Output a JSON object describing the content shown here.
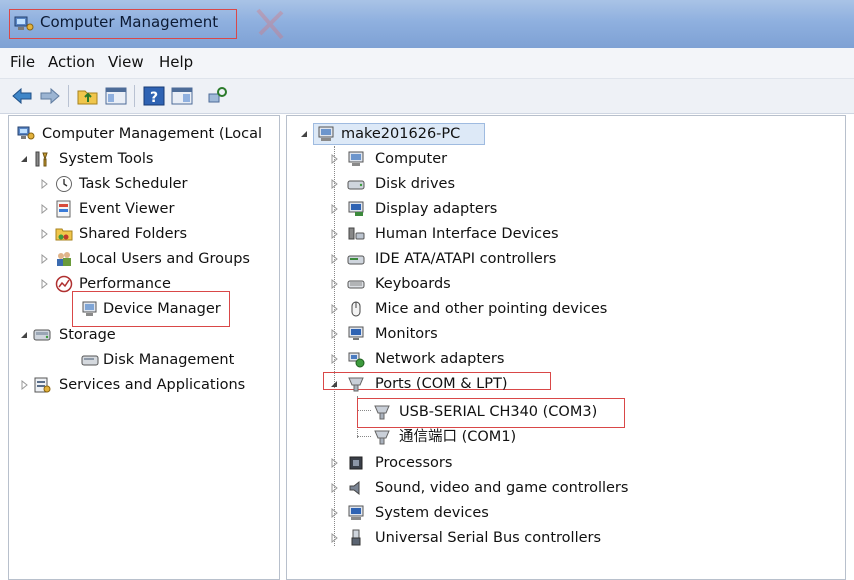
{
  "window": {
    "title": "Computer Management"
  },
  "menu": {
    "items": [
      "File",
      "Action",
      "View",
      "Help"
    ]
  },
  "toolbar": {
    "buttons": [
      "back-icon",
      "forward-icon",
      "up-folder-icon",
      "show-hide-tree-icon",
      "help-icon",
      "properties-icon",
      "refresh-icon"
    ]
  },
  "left_tree": {
    "root": "Computer Management (Local",
    "items": [
      {
        "label": "System Tools",
        "icon": "tools-icon",
        "expanded": true
      },
      {
        "label": "Task Scheduler",
        "icon": "clock-icon"
      },
      {
        "label": "Event Viewer",
        "icon": "event-viewer-icon"
      },
      {
        "label": "Shared Folders",
        "icon": "shared-folder-icon"
      },
      {
        "label": "Local Users and Groups",
        "icon": "users-icon"
      },
      {
        "label": "Performance",
        "icon": "performance-icon"
      },
      {
        "label": "Device Manager",
        "icon": "device-manager-icon",
        "highlighted": true
      },
      {
        "label": "Storage",
        "icon": "storage-icon",
        "expanded": true
      },
      {
        "label": "Disk Management",
        "icon": "disk-management-icon"
      },
      {
        "label": "Services and Applications",
        "icon": "services-icon"
      }
    ]
  },
  "right_tree": {
    "root": "make201626-PC",
    "categories": [
      {
        "label": "Computer",
        "icon": "computer-icon"
      },
      {
        "label": "Disk drives",
        "icon": "disk-drive-icon"
      },
      {
        "label": "Display adapters",
        "icon": "display-adapter-icon"
      },
      {
        "label": "Human Interface Devices",
        "icon": "hid-icon"
      },
      {
        "label": "IDE ATA/ATAPI controllers",
        "icon": "ide-icon"
      },
      {
        "label": "Keyboards",
        "icon": "keyboard-icon"
      },
      {
        "label": "Mice and other pointing devices",
        "icon": "mouse-icon"
      },
      {
        "label": "Monitors",
        "icon": "monitor-icon"
      },
      {
        "label": "Network adapters",
        "icon": "network-icon"
      },
      {
        "label": "Ports (COM & LPT)",
        "icon": "port-icon",
        "expanded": true
      },
      {
        "label": "Processors",
        "icon": "processor-icon"
      },
      {
        "label": "Sound, video and game controllers",
        "icon": "sound-icon"
      },
      {
        "label": "System devices",
        "icon": "system-device-icon"
      },
      {
        "label": "Universal Serial Bus controllers",
        "icon": "usb-icon"
      }
    ],
    "ports": [
      {
        "label": "USB-SERIAL CH340 (COM3)",
        "icon": "port-icon",
        "highlighted": true
      },
      {
        "label": "通信端口 (COM1)",
        "icon": "port-icon"
      }
    ]
  },
  "colors": {
    "highlight_border": "#d94848",
    "title_bar": "#8fb0df",
    "selection": "#dde9f7"
  }
}
